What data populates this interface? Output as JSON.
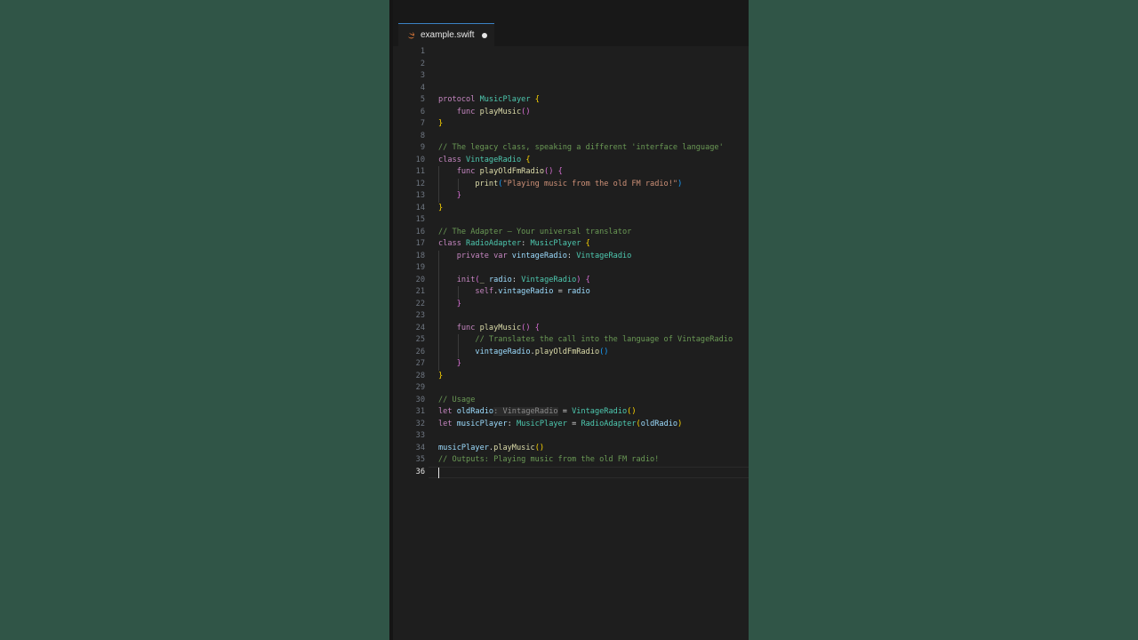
{
  "tab": {
    "filename": "example.swift"
  },
  "active_line": 36,
  "lines": [
    [],
    [],
    [],
    [],
    [
      [
        "kw",
        "protocol "
      ],
      [
        "ty",
        "MusicPlayer"
      ],
      [
        "pl",
        " "
      ],
      [
        "br1",
        "{"
      ]
    ],
    [
      [
        "pl",
        "    "
      ],
      [
        "kw",
        "func "
      ],
      [
        "fn",
        "playMusic"
      ],
      [
        "br2",
        "()"
      ]
    ],
    [
      [
        "br1",
        "}"
      ]
    ],
    [],
    [
      [
        "cm",
        "// The legacy class, speaking a different 'interface language'"
      ]
    ],
    [
      [
        "kw",
        "class "
      ],
      [
        "ty",
        "VintageRadio"
      ],
      [
        "pl",
        " "
      ],
      [
        "br1",
        "{"
      ]
    ],
    [
      [
        "pl",
        "    "
      ],
      [
        "kw",
        "func "
      ],
      [
        "fn",
        "playOldFmRadio"
      ],
      [
        "br2",
        "()"
      ],
      [
        "pl",
        " "
      ],
      [
        "br2",
        "{"
      ]
    ],
    [
      [
        "pl",
        "        "
      ],
      [
        "fn",
        "print"
      ],
      [
        "br3",
        "("
      ],
      [
        "st",
        "\"Playing music from the old FM radio!\""
      ],
      [
        "br3",
        ")"
      ]
    ],
    [
      [
        "pl",
        "    "
      ],
      [
        "br2",
        "}"
      ]
    ],
    [
      [
        "br1",
        "}"
      ]
    ],
    [],
    [
      [
        "cm",
        "// The Adapter — Your universal translator"
      ]
    ],
    [
      [
        "kw",
        "class "
      ],
      [
        "ty",
        "RadioAdapter"
      ],
      [
        "pl",
        ": "
      ],
      [
        "ty",
        "MusicPlayer"
      ],
      [
        "pl",
        " "
      ],
      [
        "br1",
        "{"
      ]
    ],
    [
      [
        "pl",
        "    "
      ],
      [
        "kw",
        "private var "
      ],
      [
        "vr",
        "vintageRadio"
      ],
      [
        "pl",
        ": "
      ],
      [
        "ty",
        "VintageRadio"
      ]
    ],
    [],
    [
      [
        "pl",
        "    "
      ],
      [
        "kw",
        "init"
      ],
      [
        "br2",
        "("
      ],
      [
        "fn",
        "_"
      ],
      [
        "pl",
        " "
      ],
      [
        "vr",
        "radio"
      ],
      [
        "pl",
        ": "
      ],
      [
        "ty",
        "VintageRadio"
      ],
      [
        "br2",
        ")"
      ],
      [
        "pl",
        " "
      ],
      [
        "br2",
        "{"
      ]
    ],
    [
      [
        "pl",
        "        "
      ],
      [
        "kw",
        "self"
      ],
      [
        "pl",
        "."
      ],
      [
        "vr",
        "vintageRadio"
      ],
      [
        "pl",
        " = "
      ],
      [
        "vr",
        "radio"
      ]
    ],
    [
      [
        "pl",
        "    "
      ],
      [
        "br2",
        "}"
      ]
    ],
    [],
    [
      [
        "pl",
        "    "
      ],
      [
        "kw",
        "func "
      ],
      [
        "fn",
        "playMusic"
      ],
      [
        "br2",
        "()"
      ],
      [
        "pl",
        " "
      ],
      [
        "br2",
        "{"
      ]
    ],
    [
      [
        "pl",
        "        "
      ],
      [
        "cm",
        "// Translates the call into the language of VintageRadio"
      ]
    ],
    [
      [
        "pl",
        "        "
      ],
      [
        "vr",
        "vintageRadio"
      ],
      [
        "pl",
        "."
      ],
      [
        "fn",
        "playOldFmRadio"
      ],
      [
        "br3",
        "()"
      ]
    ],
    [
      [
        "pl",
        "    "
      ],
      [
        "br2",
        "}"
      ]
    ],
    [
      [
        "br1",
        "}"
      ]
    ],
    [],
    [
      [
        "cm",
        "// Usage"
      ]
    ],
    [
      [
        "kw",
        "let "
      ],
      [
        "vr",
        "oldRadio"
      ],
      [
        "hint",
        ": VintageRadio"
      ],
      [
        "pl",
        " = "
      ],
      [
        "ty",
        "VintageRadio"
      ],
      [
        "br1",
        "()"
      ]
    ],
    [
      [
        "kw",
        "let "
      ],
      [
        "vr",
        "musicPlayer"
      ],
      [
        "pl",
        ": "
      ],
      [
        "ty",
        "MusicPlayer"
      ],
      [
        "pl",
        " = "
      ],
      [
        "ty",
        "RadioAdapter"
      ],
      [
        "br1",
        "("
      ],
      [
        "vr",
        "oldRadio"
      ],
      [
        "br1",
        ")"
      ]
    ],
    [],
    [
      [
        "vr",
        "musicPlayer"
      ],
      [
        "pl",
        "."
      ],
      [
        "fn",
        "playMusic"
      ],
      [
        "br1",
        "()"
      ]
    ],
    [
      [
        "cm",
        "// Outputs: Playing music from the old FM radio!"
      ]
    ],
    []
  ]
}
